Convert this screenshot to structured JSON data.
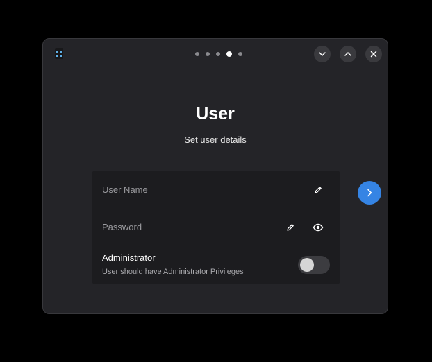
{
  "window": {
    "app_icon": "installer-app-icon",
    "steps": {
      "total": 5,
      "current": 4
    },
    "controls": {
      "minimize_icon": "chevron-down-icon",
      "maximize_icon": "chevron-up-icon",
      "close_icon": "close-icon"
    }
  },
  "page": {
    "title": "User",
    "subtitle": "Set user details"
  },
  "form": {
    "username_placeholder": "User Name",
    "password_placeholder": "Password",
    "admin_label": "Administrator",
    "admin_description": "User should have Administrator Privileges",
    "admin_enabled": false,
    "icons": {
      "edit": "pencil-icon",
      "reveal": "eye-icon"
    }
  },
  "next_button": {
    "icon": "chevron-right-icon"
  },
  "colors": {
    "accent": "#3584e4",
    "window_bg": "#242428",
    "card_bg": "#1c1c1f"
  }
}
